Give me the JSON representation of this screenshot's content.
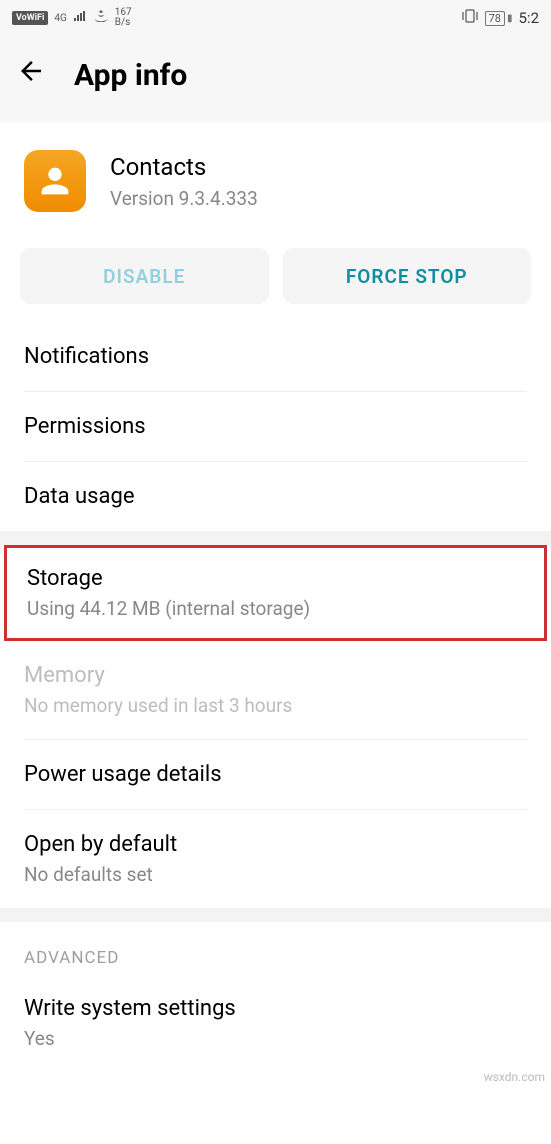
{
  "status_bar": {
    "vowifi": "VoWiFi",
    "network": "4G",
    "speed_top": "167",
    "speed_bottom": "B/s",
    "vibrate_icon": "▯",
    "battery_level": "78",
    "time": "5:2"
  },
  "header": {
    "title": "App info"
  },
  "app": {
    "name": "Contacts",
    "version": "Version 9.3.4.333"
  },
  "buttons": {
    "disable": "DISABLE",
    "force_stop": "FORCE STOP"
  },
  "items": {
    "notifications": {
      "title": "Notifications"
    },
    "permissions": {
      "title": "Permissions"
    },
    "data_usage": {
      "title": "Data usage"
    },
    "storage": {
      "title": "Storage",
      "sub": "Using 44.12 MB (internal storage)"
    },
    "memory": {
      "title": "Memory",
      "sub": "No memory used in last 3 hours"
    },
    "power": {
      "title": "Power usage details"
    },
    "open_default": {
      "title": "Open by default",
      "sub": "No defaults set"
    },
    "advanced_header": "ADVANCED",
    "write_system": {
      "title": "Write system settings",
      "sub": "Yes"
    }
  },
  "watermark": "wsxdn.com"
}
